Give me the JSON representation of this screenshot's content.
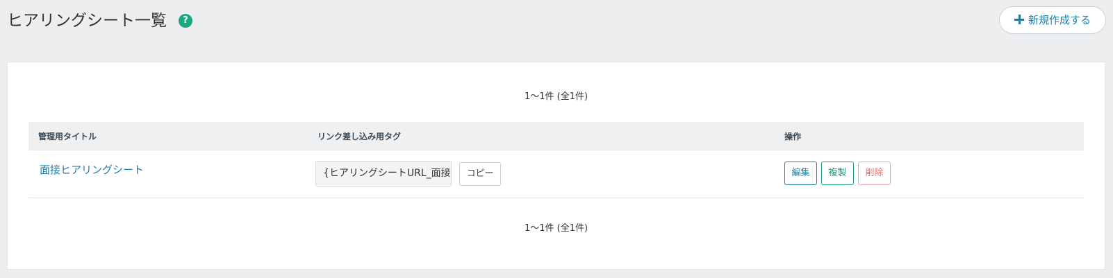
{
  "header": {
    "title": "ヒアリングシート一覧",
    "help_icon": "?",
    "new_button_label": "新規作成する"
  },
  "pager": {
    "top_count": "1〜1件 (全1件)",
    "bottom_count": "1〜1件 (全1件)"
  },
  "table": {
    "columns": [
      "管理用タイトル",
      "リンク差し込み用タグ",
      "操作"
    ],
    "rows": [
      {
        "title": "面接ヒアリングシート",
        "tag": "{ヒアリングシートURL_面接ヒアリングシート}",
        "copy_label": "コピー",
        "actions": [
          "編集",
          "複製",
          "削除"
        ]
      }
    ]
  },
  "colors": {
    "accent": "#1a7fa8",
    "help": "#1aa87f",
    "duplicate": "#1a9a7f",
    "delete": "#e26b6b"
  }
}
